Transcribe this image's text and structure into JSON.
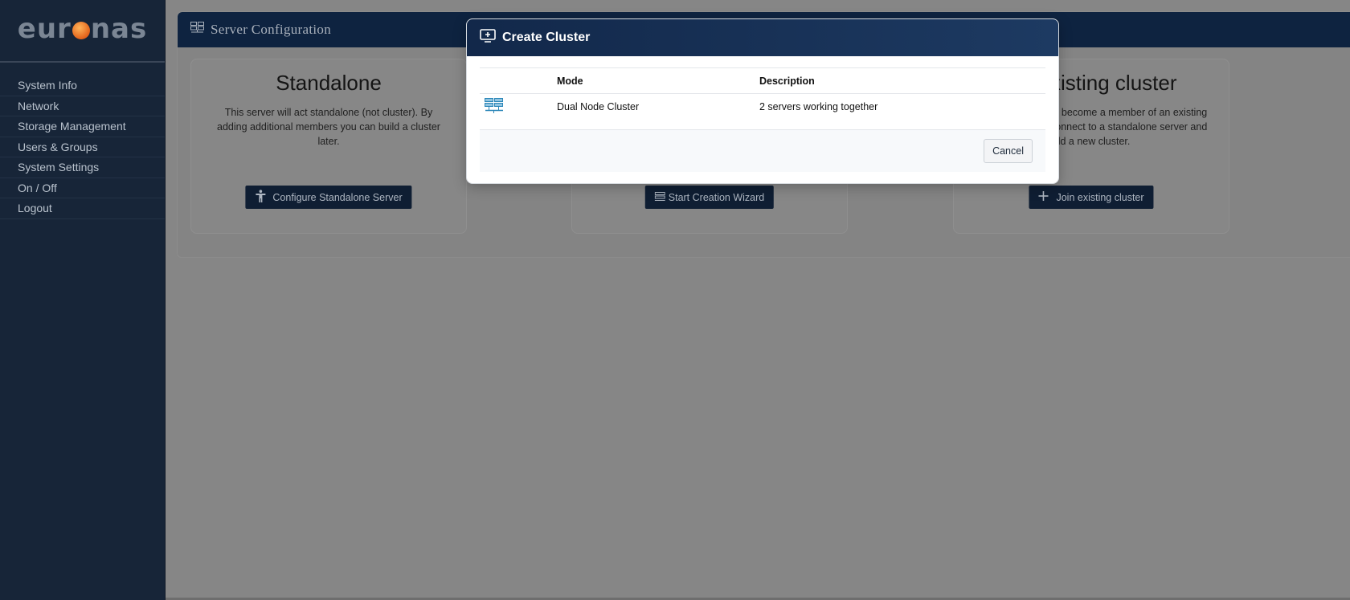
{
  "brand": {
    "logo_left": "eur",
    "logo_right": "nas"
  },
  "sidebar": {
    "items": [
      {
        "label": "System Info"
      },
      {
        "label": "Network"
      },
      {
        "label": "Storage Management"
      },
      {
        "label": "Users & Groups"
      },
      {
        "label": "System Settings"
      },
      {
        "label": "On / Off"
      },
      {
        "label": "Logout"
      }
    ]
  },
  "panel": {
    "title": "Server Configuration",
    "icon": "server-rack-icon"
  },
  "cards": {
    "standalone": {
      "title": "Standalone",
      "description": "This server will act standalone (not cluster). By adding additional members you can build a cluster later.",
      "button": "Configure Standalone Server"
    },
    "create": {
      "button": "Start Creation Wizard"
    },
    "join": {
      "title": "xisting cluster",
      "description": " to become a member of an existing  connect to a standalone server and uild a new cluster.",
      "button": "Join existing cluster"
    }
  },
  "modal": {
    "title": "Create Cluster",
    "columns": [
      "",
      "Mode",
      "Description"
    ],
    "rows": [
      {
        "icon": "cluster-server-icon",
        "mode": "Dual Node Cluster",
        "description": "2 servers working together"
      }
    ],
    "cancel": "Cancel"
  },
  "colors": {
    "sidebar": "#172538",
    "header": "#0e2340",
    "modal_header": "#12284a",
    "overlay": "#868686",
    "logo_dot": "#e3621a"
  }
}
